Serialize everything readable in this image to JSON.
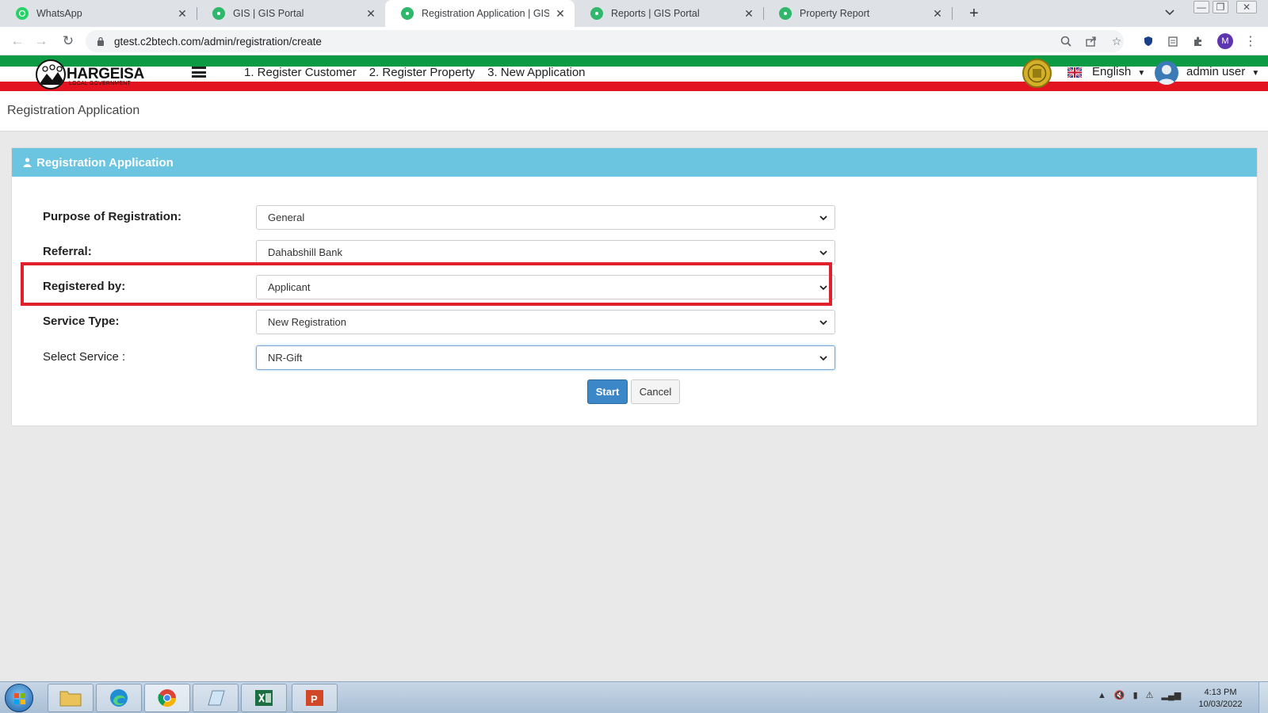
{
  "browser": {
    "tabs": [
      {
        "title": "WhatsApp",
        "icon": "whatsapp-icon",
        "active": false
      },
      {
        "title": "GIS | GIS Portal",
        "icon": "gis-portal-icon",
        "active": false
      },
      {
        "title": "Registration Application | GIS Po",
        "icon": "gis-portal-icon",
        "active": true
      },
      {
        "title": "Reports | GIS Portal",
        "icon": "gis-portal-icon",
        "active": false
      },
      {
        "title": "Property Report",
        "icon": "gis-portal-icon",
        "active": false
      }
    ],
    "url": "gtest.c2btech.com/admin/registration/create",
    "profile_initial": "M"
  },
  "app_header": {
    "logo_text": "HARGEISA",
    "logo_subtext": "LOCAL GOVERNMENT",
    "nav": [
      "1. Register Customer",
      "2. Register Property",
      "3. New Application"
    ],
    "language": "English",
    "user": "admin user"
  },
  "page": {
    "title": "Registration Application"
  },
  "panel": {
    "title": "Registration Application",
    "fields": [
      {
        "label": "Purpose of Registration:",
        "value": "General",
        "bold": true
      },
      {
        "label": "Referral:",
        "value": "Dahabshill Bank",
        "bold": true
      },
      {
        "label": "Registered by:",
        "value": "Applicant",
        "bold": true
      },
      {
        "label": "Service Type:",
        "value": "New Registration",
        "bold": true
      },
      {
        "label": "Select Service :",
        "value": "NR-Gift",
        "bold": false
      }
    ],
    "start_label": "Start",
    "cancel_label": "Cancel"
  },
  "colors": {
    "panel_heading": "#6bc4e0",
    "primary_button": "#3c87c7",
    "highlight": "#e0202a",
    "header_green": "#0d9a44",
    "header_red": "#e1141f"
  },
  "taskbar": {
    "apps": [
      "file-explorer-icon",
      "edge-icon",
      "chrome-icon",
      "notepad-icon",
      "excel-icon",
      "powerpoint-icon"
    ],
    "time": "4:13 PM",
    "date": "10/03/2022"
  }
}
